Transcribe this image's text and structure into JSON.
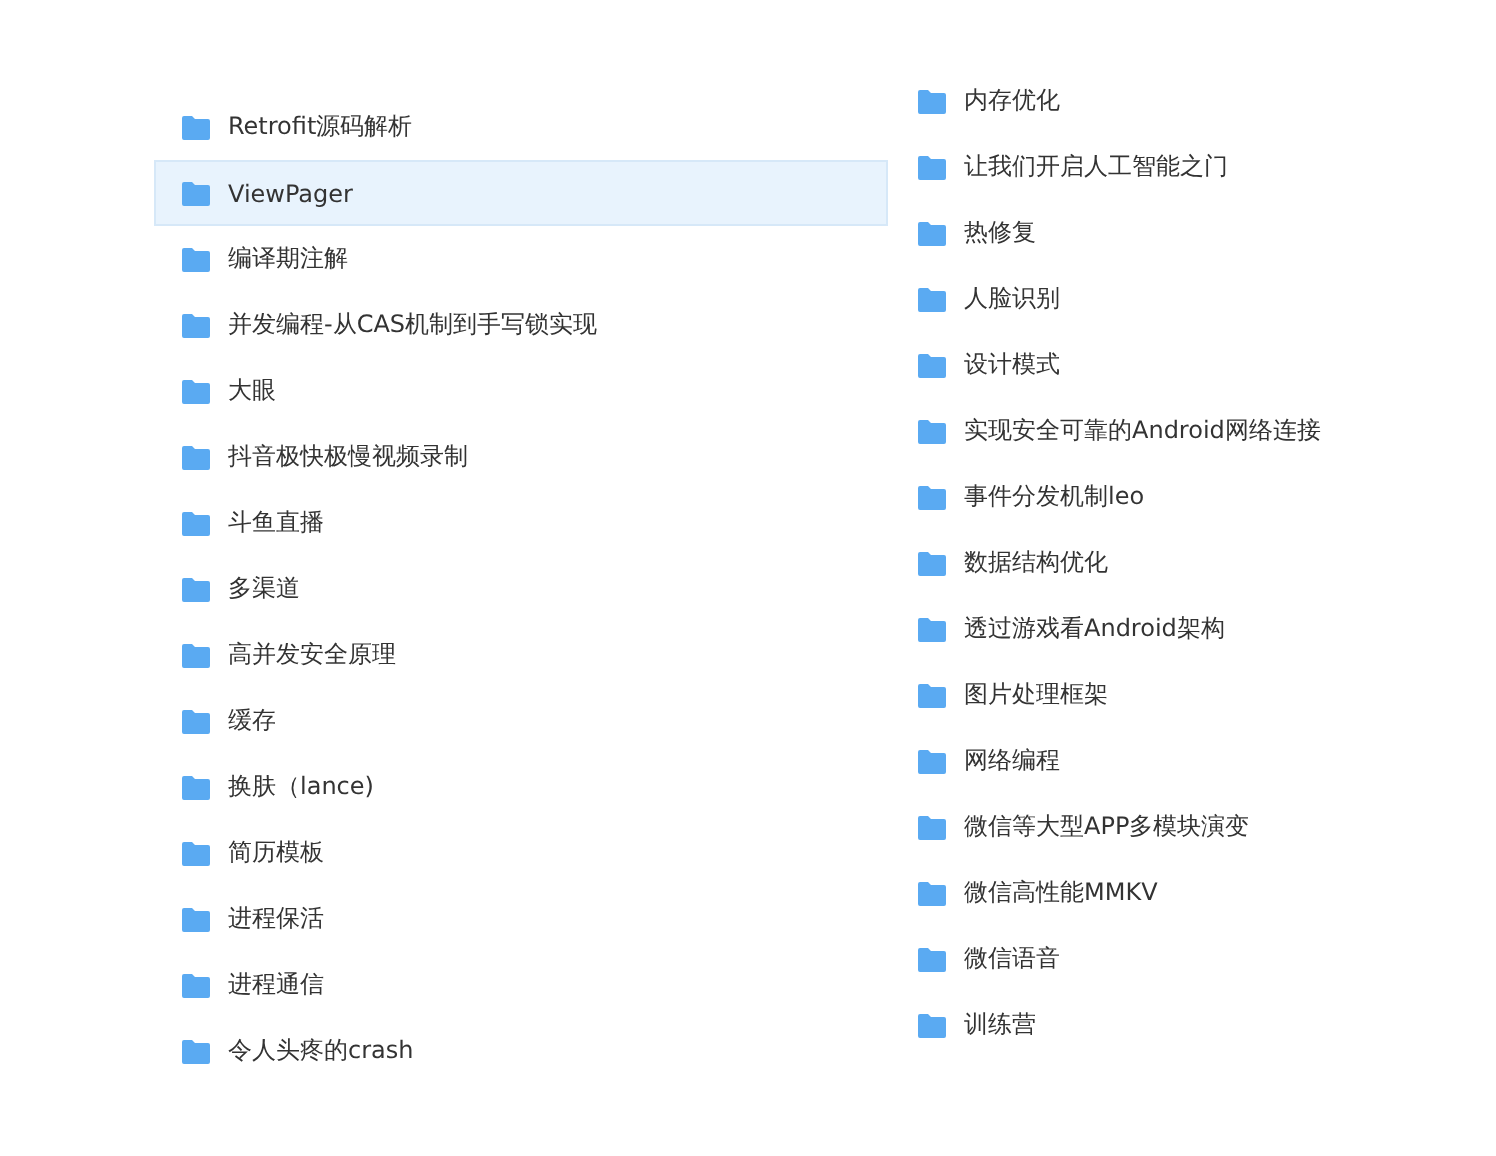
{
  "columns": [
    {
      "items": [
        {
          "label": "Retrofit源码解析",
          "selected": false
        },
        {
          "label": "ViewPager",
          "selected": true
        },
        {
          "label": "编译期注解",
          "selected": false
        },
        {
          "label": "并发编程-从CAS机制到手写锁实现",
          "selected": false
        },
        {
          "label": "大眼",
          "selected": false
        },
        {
          "label": "抖音极快极慢视频录制",
          "selected": false
        },
        {
          "label": "斗鱼直播",
          "selected": false
        },
        {
          "label": "多渠道",
          "selected": false
        },
        {
          "label": "高并发安全原理",
          "selected": false
        },
        {
          "label": "缓存",
          "selected": false
        },
        {
          "label": "换肤（lance)",
          "selected": false
        },
        {
          "label": "简历模板",
          "selected": false
        },
        {
          "label": "进程保活",
          "selected": false
        },
        {
          "label": "进程通信",
          "selected": false
        },
        {
          "label": "令人头疼的crash",
          "selected": false
        }
      ]
    },
    {
      "items": [
        {
          "label": "内存优化",
          "selected": false
        },
        {
          "label": "让我们开启人工智能之门",
          "selected": false
        },
        {
          "label": "热修复",
          "selected": false
        },
        {
          "label": "人脸识别",
          "selected": false
        },
        {
          "label": "设计模式",
          "selected": false
        },
        {
          "label": "实现安全可靠的Android网络连接",
          "selected": false
        },
        {
          "label": "事件分发机制leo",
          "selected": false
        },
        {
          "label": "数据结构优化",
          "selected": false
        },
        {
          "label": "透过游戏看Android架构",
          "selected": false
        },
        {
          "label": "图片处理框架",
          "selected": false
        },
        {
          "label": "网络编程",
          "selected": false
        },
        {
          "label": "微信等大型APP多模块演变",
          "selected": false
        },
        {
          "label": "微信高性能MMKV",
          "selected": false
        },
        {
          "label": "微信语音",
          "selected": false
        },
        {
          "label": "训练营",
          "selected": false
        }
      ]
    }
  ]
}
